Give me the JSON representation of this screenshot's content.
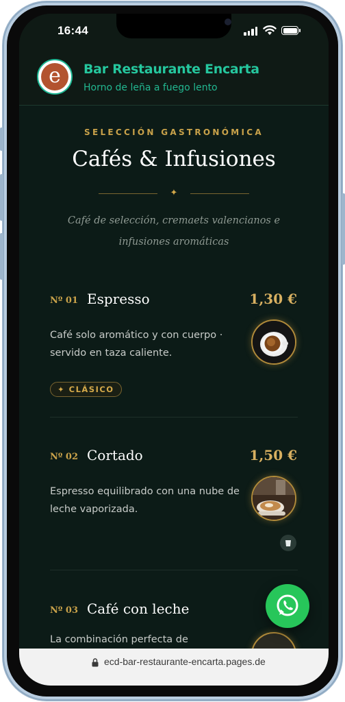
{
  "status_bar": {
    "time": "16:44"
  },
  "header": {
    "logo_letter": "e",
    "brand_name": "Bar Restaurante Encarta",
    "tagline": "Horno de leña a fuego lento"
  },
  "section": {
    "kicker": "SELECCIÓN GASTRONÓMICA",
    "title": "Cafés & Infusiones",
    "subtitle": "Café de selección, cremaets valencianos e infusiones aromáticas"
  },
  "items": [
    {
      "number": "Nº 01",
      "name": "Espresso",
      "price": "1,30 €",
      "description": "Café solo aromático y con cuerpo · servido en taza caliente.",
      "badge": "✦ CLÁSICO"
    },
    {
      "number": "Nº 02",
      "name": "Cortado",
      "price": "1,50 €",
      "description": "Espresso equilibrado con una nube de leche vaporizada."
    },
    {
      "number": "Nº 03",
      "name": "Café con leche",
      "price": "1,",
      "description": "La combinación perfecta de"
    }
  ],
  "browser": {
    "url": "ecd-bar-restaurante-encarta.pages.de"
  },
  "colors": {
    "accent_green": "#25c79e",
    "gold": "#c9a24a",
    "background": "#0c1b17",
    "whatsapp": "#27c65a"
  },
  "icons": [
    "signal-icon",
    "wifi-icon",
    "battery-icon",
    "sparkle-icon",
    "cup-icon",
    "whatsapp-icon",
    "lock-icon"
  ]
}
